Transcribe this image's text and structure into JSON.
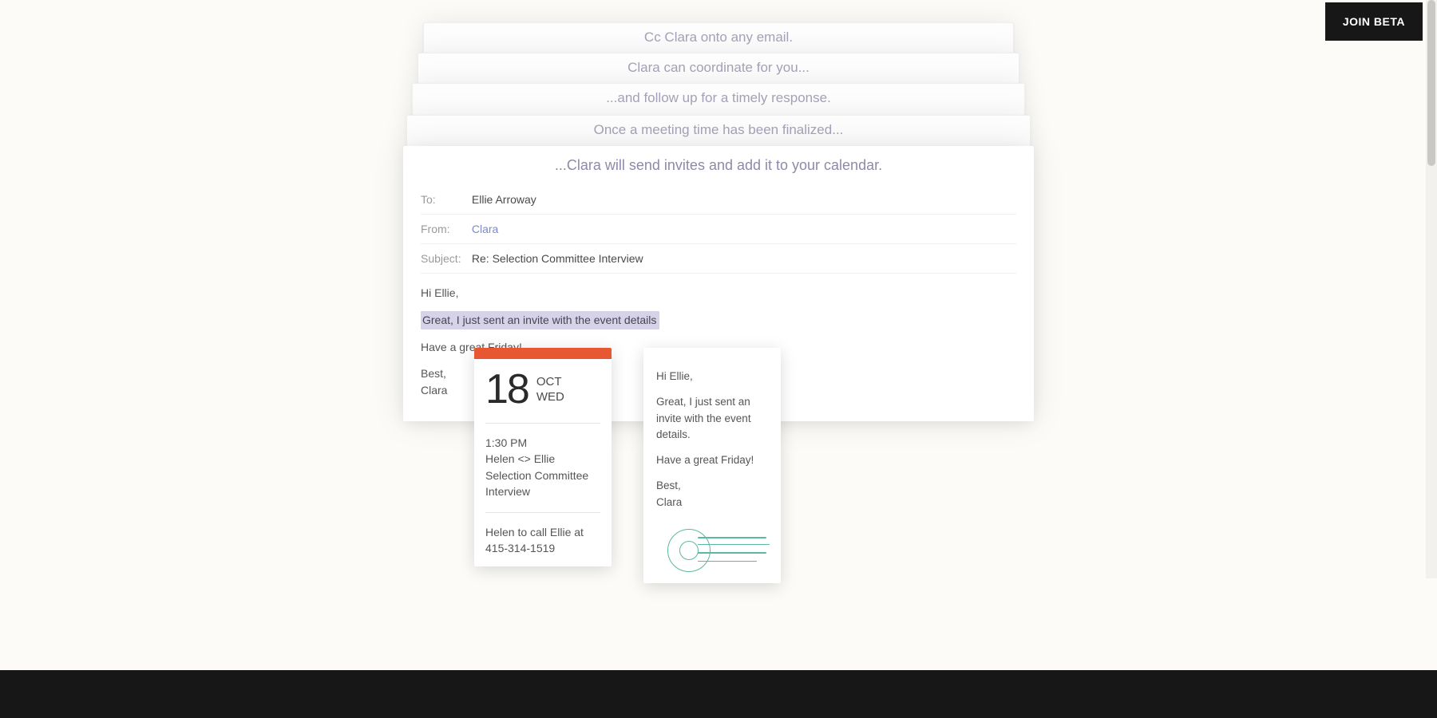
{
  "cta": {
    "join_beta": "JOIN BETA"
  },
  "steps": {
    "s1": "Cc Clara onto any email.",
    "s2": "Clara can coordinate for you...",
    "s3": "...and follow up for a timely response.",
    "s4": "Once a meeting time has been finalized..."
  },
  "email": {
    "headline": "...Clara will send invites and add it to your calendar.",
    "to_label": "To:",
    "to_value": "Ellie Arroway",
    "from_label": "From:",
    "from_value": "Clara",
    "subject_label": "Subject:",
    "subject_value": "Re: Selection Committee Interview",
    "body": {
      "greeting": "Hi Ellie,",
      "line1": "Great, I just sent an invite with the event details",
      "line2": "Have a great Friday!",
      "signoff1": "Best,",
      "signoff2": "Clara"
    }
  },
  "calendar": {
    "accent": "#e75732",
    "day": "18",
    "month": "OCT",
    "weekday": "WED",
    "time": "1:30 PM",
    "title1": "Helen <> Ellie",
    "title2": "Selection Committee Interview",
    "detail": "Helen to call Ellie at 415-314-1519"
  },
  "note": {
    "greeting": "Hi Ellie,",
    "line1": "Great, I just sent an invite with the event details.",
    "line2": "Have a great Friday!",
    "signoff1": "Best,",
    "signoff2": "Clara",
    "stamp_color": "#5bb8a2"
  }
}
